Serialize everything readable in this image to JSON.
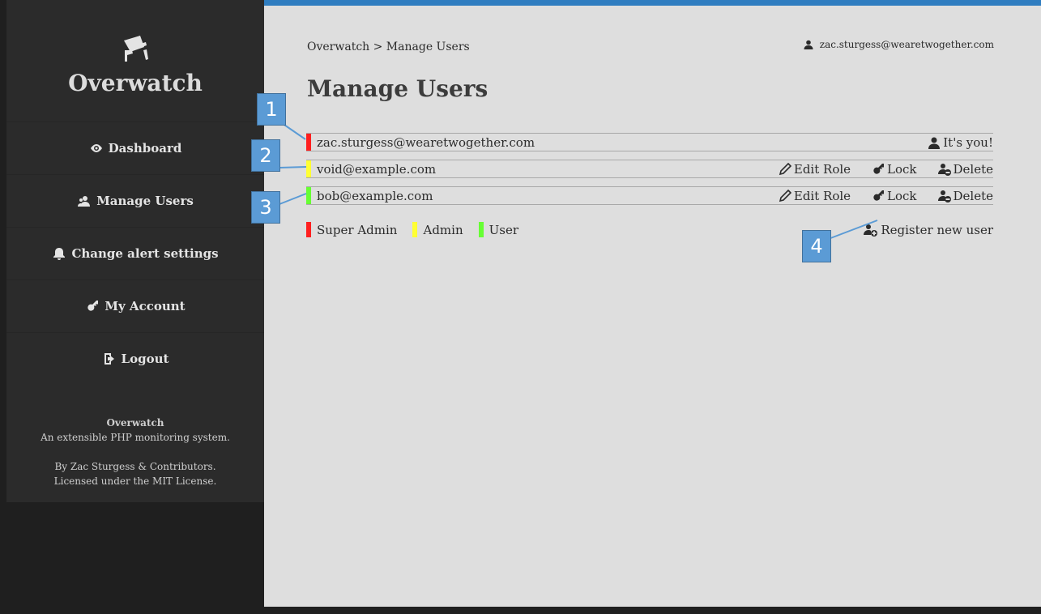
{
  "app": {
    "title": "Overwatch"
  },
  "sidebar": {
    "items": [
      {
        "label": "Dashboard",
        "icon": "eye-icon"
      },
      {
        "label": "Manage Users",
        "icon": "users-icon"
      },
      {
        "label": "Change alert settings",
        "icon": "bell-icon"
      },
      {
        "label": "My Account",
        "icon": "key-icon"
      },
      {
        "label": "Logout",
        "icon": "logout-icon"
      }
    ],
    "footer": {
      "name": "Overwatch",
      "tagline": "An extensible PHP monitoring system.",
      "credit": "By Zac Sturgess & Contributors.",
      "license_prefix": "Licensed under the ",
      "license_link": "MIT License",
      "license_suffix": "."
    }
  },
  "header": {
    "breadcrumb": "Overwatch > Manage Users",
    "current_user": "zac.sturgess@wearetwogether.com",
    "title": "Manage Users"
  },
  "users": [
    {
      "email": "zac.sturgess@wearetwogether.com",
      "role": "Super Admin",
      "self_label": "It's you!"
    },
    {
      "email": "void@example.com",
      "role": "Admin",
      "actions": [
        "Edit Role",
        "Lock",
        "Delete"
      ]
    },
    {
      "email": "bob@example.com",
      "role": "User",
      "actions": [
        "Edit Role",
        "Lock",
        "Delete"
      ]
    }
  ],
  "legend": [
    {
      "label": "Super Admin",
      "color": "#ff1f1f"
    },
    {
      "label": "Admin",
      "color": "#ffff33"
    },
    {
      "label": "User",
      "color": "#66ff33"
    }
  ],
  "register_label": "Register new user",
  "callouts": [
    "1",
    "2",
    "3",
    "4"
  ],
  "colors": {
    "accent": "#2f7dc0",
    "sidebar": "#2b2b2b",
    "main_bg": "#dedede",
    "callout": "#5b9bd5"
  }
}
